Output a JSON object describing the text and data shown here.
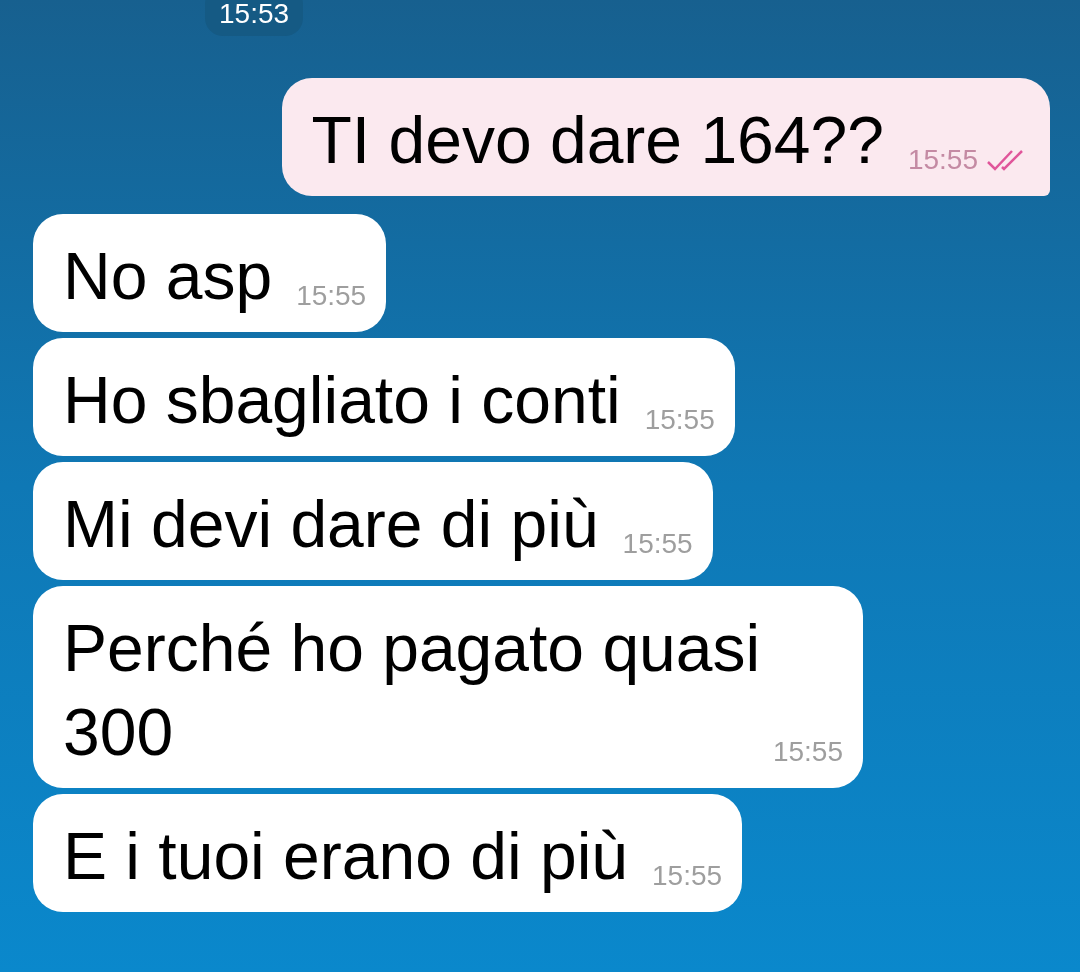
{
  "date_chip": "15:53",
  "messages": [
    {
      "kind": "outgoing",
      "text": "TI devo dare 164??",
      "time": "15:55",
      "read": true
    },
    {
      "kind": "incoming",
      "text": "No asp",
      "time": "15:55"
    },
    {
      "kind": "incoming",
      "text": "Ho sbagliato i conti",
      "time": "15:55"
    },
    {
      "kind": "incoming",
      "text": "Mi devi dare di più",
      "time": "15:55"
    },
    {
      "kind": "incoming",
      "text": "Perché ho pagato quasi 300",
      "time": "15:55"
    },
    {
      "kind": "incoming",
      "text": "E i tuoi erano di più",
      "time": "15:55"
    }
  ]
}
